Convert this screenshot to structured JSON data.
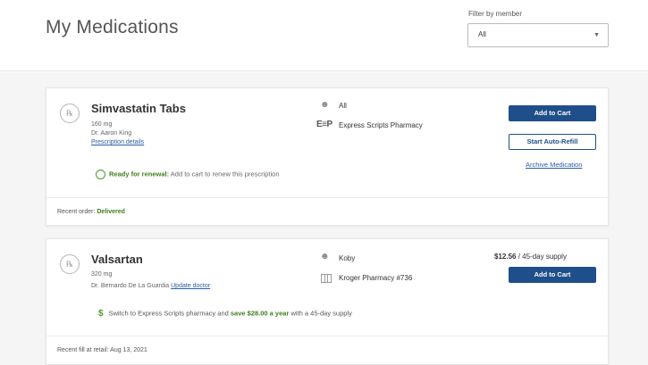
{
  "header": {
    "title": "My Medications",
    "filter_label": "Filter by member",
    "filter_value": "All"
  },
  "medications": [
    {
      "name": "Simvastatin Tabs",
      "dose": "160 mg",
      "doctor": "Dr. Aaron King",
      "details_link": "Prescription details",
      "member": "All",
      "pharmacy_logo": "E≡P",
      "pharmacy": "Express Scripts Pharmacy",
      "add_to_cart": "Add to Cart",
      "auto_refill": "Start Auto-Refill",
      "archive": "Archive Medication",
      "renewal_strong": "Ready for renewal:",
      "renewal_text": "Add to cart to renew this prescription",
      "recent_label": "Recent order:",
      "recent_status": "Delivered"
    },
    {
      "name": "Valsartan",
      "dose": "320 mg",
      "doctor": "Dr. Bernardo De La Guardia",
      "update_link": "Update doctor",
      "member": "Koby",
      "pharmacy": "Kroger Pharmacy #736",
      "price": "$12.56",
      "price_suffix": "/ 45-day supply",
      "add_to_cart": "Add to Cart",
      "savings_pre": "Switch to Express Scripts pharmacy and",
      "savings_strong": "save $28.00 a year",
      "savings_post": "with a 45-day supply",
      "recent_label": "Recent fill at retail:",
      "recent_date": "Aug 13, 2021"
    }
  ]
}
